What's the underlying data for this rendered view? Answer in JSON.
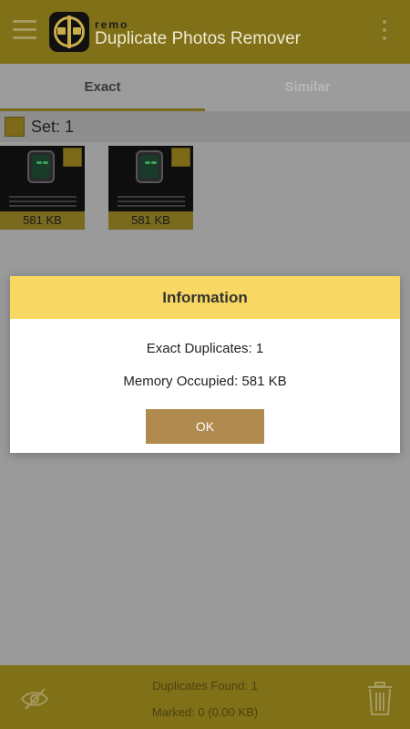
{
  "header": {
    "brand": "remo",
    "title": "Duplicate Photos Remover"
  },
  "tabs": [
    {
      "label": "Exact",
      "active": true
    },
    {
      "label": "Similar",
      "active": false
    }
  ],
  "set": {
    "label": "Set: 1"
  },
  "thumbnails": [
    {
      "size": "581 KB"
    },
    {
      "size": "581 KB"
    }
  ],
  "footer": {
    "duplicates_found": "Duplicates Found: 1",
    "marked": "Marked: 0 (0.00 KB)"
  },
  "dialog": {
    "title": "Information",
    "exact_duplicates": "Exact Duplicates: 1",
    "memory_occupied": "Memory Occupied: 581 KB",
    "ok_label": "OK"
  },
  "icons": {
    "menu": "hamburger-menu-icon",
    "more": "vertical-dots-icon",
    "hide": "eye-slash-icon",
    "delete": "trash-icon"
  },
  "colors": {
    "accent": "#807018",
    "dialog_header": "#f8d862",
    "ok_button": "#b08a4e"
  }
}
